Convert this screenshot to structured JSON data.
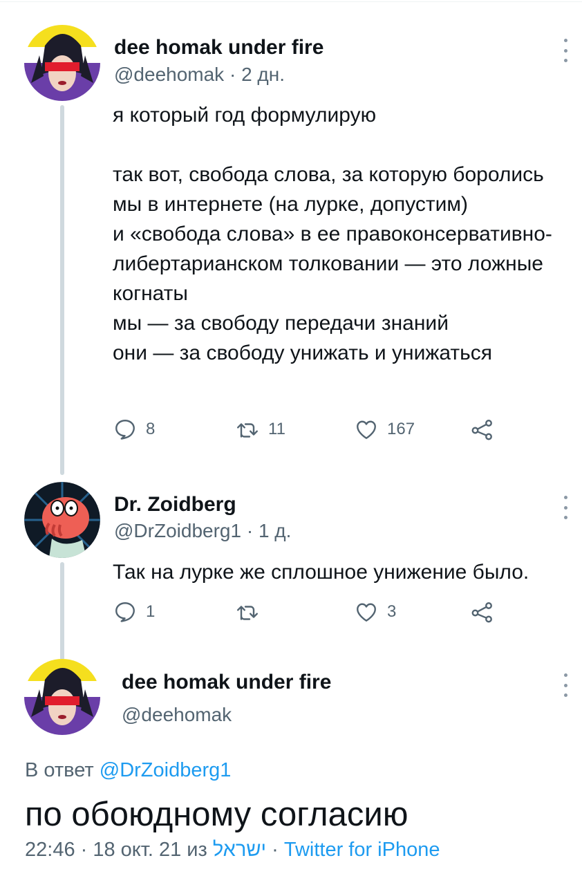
{
  "tweets": [
    {
      "author_name": "dee homak under fire",
      "handle": "@deehomak",
      "time": " · 2 дн.",
      "text": "я который год формулирую\n\nтак вот, свобода слова, за которую боролись мы в интернете (на лурке, допустим)\nи «свобода слова» в ее правоконсервативно-либертарианском толковании — это ложные когнаты\nмы — за свободу передачи знаний\nони — за свободу унижать и унижаться",
      "replies": "8",
      "retweets": "11",
      "likes": "167"
    },
    {
      "author_name": "Dr. Zoidberg",
      "handle": "@DrZoidberg1",
      "time": " · 1 д.",
      "text": "Так на лурке же сплошное унижение было.",
      "replies": "1",
      "retweets": "",
      "likes": "3"
    }
  ],
  "main_tweet": {
    "author_name": "dee homak under fire",
    "handle": "@deehomak",
    "reply_prefix": "В ответ ",
    "reply_mention": "@DrZoidberg1",
    "text": "по обоюдному согласию",
    "timestamp": "22:46 · 18 окт. 21 из ",
    "location": "ישראל",
    "separator": " · ",
    "source": "Twitter for iPhone"
  },
  "icons": {
    "reply": "reply-icon",
    "retweet": "retweet-icon",
    "like": "heart-icon",
    "share": "share-icon",
    "more": "more-vertical-icon"
  },
  "colors": {
    "text": "#0f1419",
    "secondary": "#536471",
    "link": "#1d9bf0",
    "thread_line": "#cfd9de"
  }
}
